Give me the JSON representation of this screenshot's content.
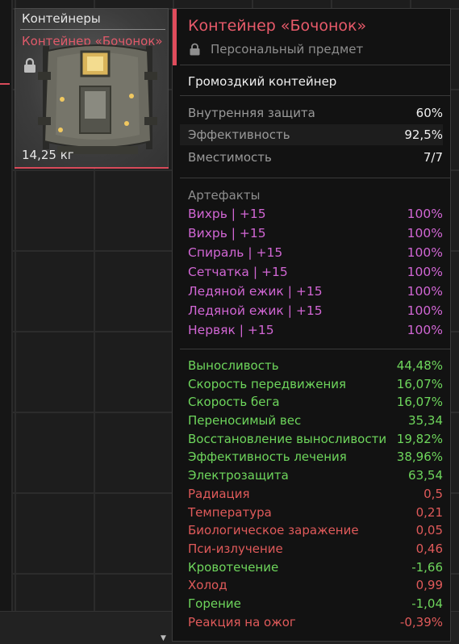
{
  "slot": {
    "category": "Контейнеры",
    "name": "Контейнер «Бочонок»",
    "weight": "14,25 кг"
  },
  "tooltip": {
    "title": "Контейнер «Бочонок»",
    "personal": "Персональный предмет",
    "type": "Громоздкий контейнер",
    "props": [
      {
        "label": "Внутренняя защита",
        "value": "60%"
      },
      {
        "label": "Эффективность",
        "value": "92,5%"
      },
      {
        "label": "Вместимость",
        "value": "7/7"
      }
    ],
    "artifacts_header": "Артефакты",
    "artifacts": [
      {
        "label": "Вихрь | +15",
        "value": "100%"
      },
      {
        "label": "Вихрь | +15",
        "value": "100%"
      },
      {
        "label": "Спираль | +15",
        "value": "100%"
      },
      {
        "label": "Сетчатка | +15",
        "value": "100%"
      },
      {
        "label": "Ледяной ежик | +15",
        "value": "100%"
      },
      {
        "label": "Ледяной ежик | +15",
        "value": "100%"
      },
      {
        "label": "Нервяк | +15",
        "value": "100%"
      }
    ],
    "stats": [
      {
        "label": "Выносливость",
        "value": "44,48%",
        "kind": "pos"
      },
      {
        "label": "Скорость передвижения",
        "value": "16,07%",
        "kind": "pos"
      },
      {
        "label": "Скорость бега",
        "value": "16,07%",
        "kind": "pos"
      },
      {
        "label": "Переносимый вес",
        "value": "35,34",
        "kind": "pos"
      },
      {
        "label": "Восстановление выносливости",
        "value": "19,82%",
        "kind": "pos"
      },
      {
        "label": "Эффективность лечения",
        "value": "38,96%",
        "kind": "pos"
      },
      {
        "label": "Электрозащита",
        "value": "63,54",
        "kind": "pos"
      },
      {
        "label": "Радиация",
        "value": "0,5",
        "kind": "neg"
      },
      {
        "label": "Температура",
        "value": "0,21",
        "kind": "neg"
      },
      {
        "label": "Биологическое заражение",
        "value": "0,05",
        "kind": "neg"
      },
      {
        "label": "Пси-излучение",
        "value": "0,46",
        "kind": "neg"
      },
      {
        "label": "Кровотечение",
        "value": "-1,66",
        "kind": "pos"
      },
      {
        "label": "Холод",
        "value": "0,99",
        "kind": "neg"
      },
      {
        "label": "Горение",
        "value": "-1,04",
        "kind": "pos"
      },
      {
        "label": "Реакция на ожог",
        "value": "-0,39%",
        "kind": "neg"
      }
    ]
  },
  "colors": {
    "accent": "#e04c5c",
    "artifact": "#d166d4",
    "positive": "#6ed65c",
    "negative": "#e05a5a"
  },
  "icons": [
    "lock-icon",
    "container-image",
    "scroll-down-arrow-icon"
  ]
}
